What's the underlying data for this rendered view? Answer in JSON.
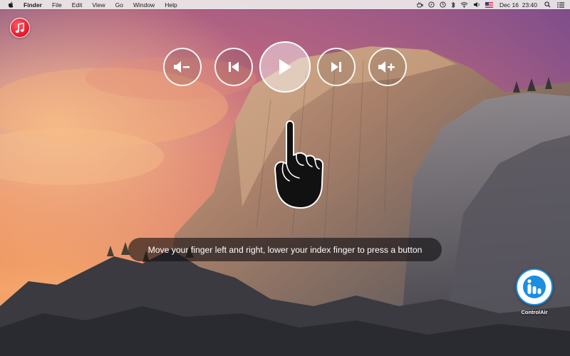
{
  "menubar": {
    "app_name": "Finder",
    "items": [
      "File",
      "Edit",
      "View",
      "Go",
      "Window",
      "Help"
    ],
    "date": "Dec 16",
    "time": "23:40"
  },
  "controls": {
    "buttons": [
      {
        "name": "volume-down",
        "icon": "volume-down-icon"
      },
      {
        "name": "previous-track",
        "icon": "skip-back-icon"
      },
      {
        "name": "play",
        "icon": "play-icon"
      },
      {
        "name": "next-track",
        "icon": "skip-forward-icon"
      },
      {
        "name": "volume-up",
        "icon": "volume-up-icon"
      }
    ]
  },
  "hint": {
    "text": "Move your finger left and right, lower your index finger to press a button"
  },
  "apps": {
    "music_icon": "music-note-icon",
    "controlair_label": "ControlAir"
  },
  "colors": {
    "accent_blue": "#1a8fe0",
    "music_red": "#e2162b"
  }
}
